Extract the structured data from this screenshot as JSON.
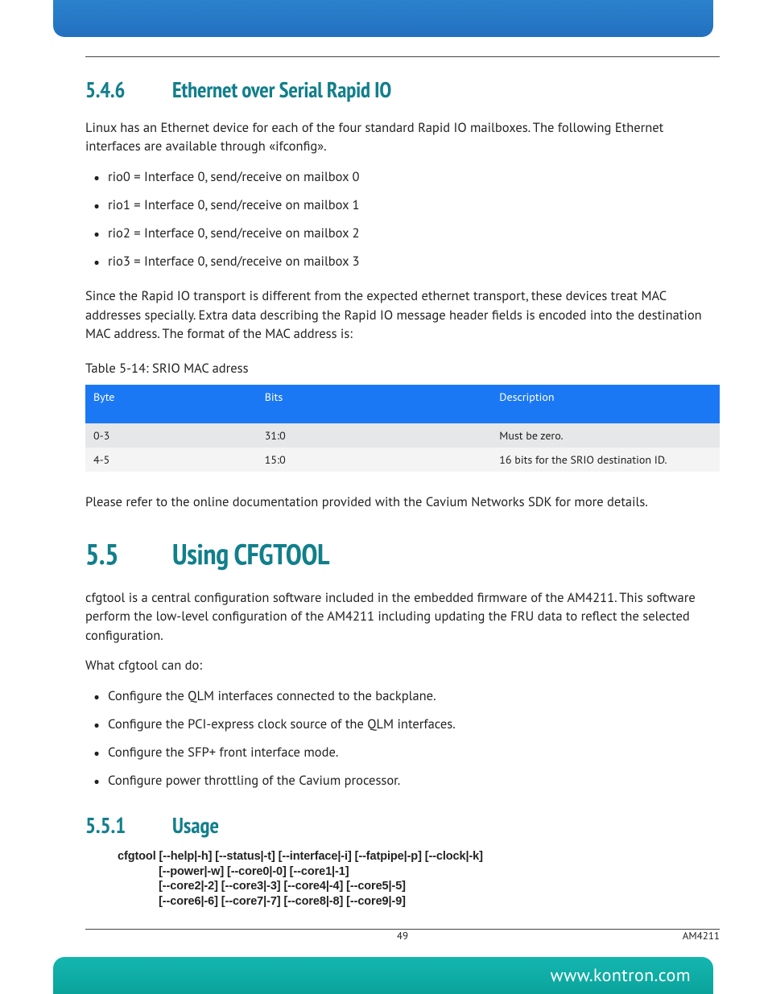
{
  "section_546": {
    "num": "5.4.6",
    "title": "Ethernet over Serial Rapid IO",
    "intro": "Linux has an Ethernet device for each of the four standard Rapid IO mailboxes. The following Ethernet interfaces are available through «ifconfig».",
    "bullets": [
      "rio0 = Interface 0, send/receive on mailbox 0",
      "rio1 = Interface 0, send/receive on mailbox 1",
      "rio2 = Interface 0, send/receive on mailbox 2",
      "rio3 = Interface 0, send/receive on mailbox 3"
    ],
    "para2": "Since the Rapid IO transport is different from the expected ethernet transport, these devices treat MAC addresses specially. Extra data describing the Rapid IO message header fields is encoded into the destination MAC address. The format of the MAC address is:",
    "table_caption": "Table 5-14: SRIO MAC adress",
    "table_headers": [
      "Byte",
      "Bits",
      "Description"
    ],
    "table_rows": [
      {
        "byte": "0-3",
        "bits": "31:0",
        "desc": "Must be zero."
      },
      {
        "byte": "4-5",
        "bits": "15:0",
        "desc": "16 bits for the SRIO destination ID."
      }
    ],
    "para3": "Please refer to the online documentation provided with the Cavium Networks SDK for more details."
  },
  "section_55": {
    "num": "5.5",
    "title": "Using CFGTOOL",
    "intro": "cfgtool is a central configuration software included in the embedded firmware of the AM4211. This software perform the low-level configuration of the AM4211 including updating the FRU data to reflect the selected configuration.",
    "lead": "What cfgtool can do:",
    "bullets": [
      "Configure the QLM interfaces connected to the backplane.",
      "Configure the PCI-express clock source of the QLM interfaces.",
      "Configure the SFP+ front interface mode.",
      "Configure power throttling of the Cavium processor."
    ]
  },
  "section_551": {
    "num": "5.5.1",
    "title": "Usage",
    "usage_lines": [
      "cfgtool [--help|-h] [--status|-t] [--interface|-i] [--fatpipe|-p] [--clock|-k]",
      "             [--power|-w] [--core0|-0] [--core1|-1]",
      "             [--core2|-2] [--core3|-3] [--core4|-4] [--core5|-5]",
      "             [--core6|-6] [--core7|-7] [--core8|-8] [--core9|-9]"
    ]
  },
  "footer": {
    "page": "49",
    "model": "AM4211",
    "url": "www.kontron.com"
  },
  "colors": {
    "heading": "#117f8c",
    "table_header_bg": "#1b78f5",
    "top_tab": "#2270c0",
    "bottom_tab": "#0aa39b"
  }
}
